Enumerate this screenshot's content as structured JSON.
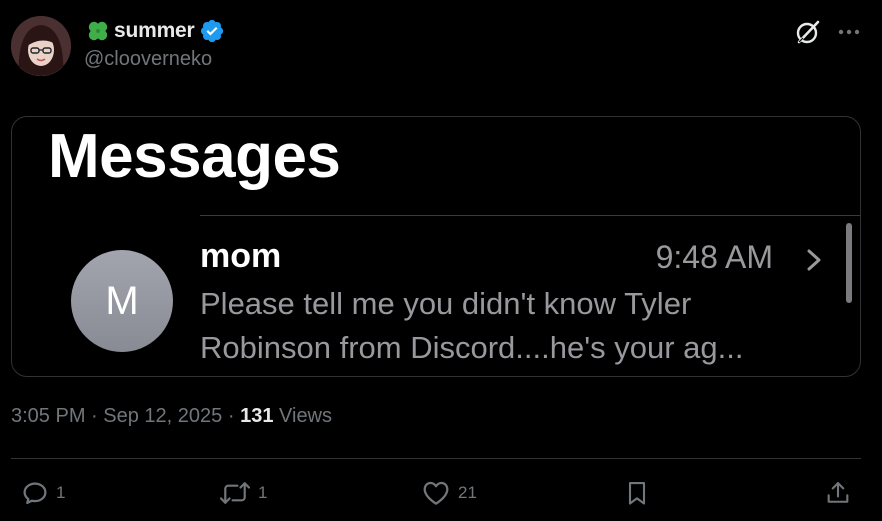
{
  "author": {
    "display_name": "summer",
    "handle": "@clooverneko",
    "name_emoji": "four-leaf-clover-icon",
    "verified": true,
    "verified_color": "#1d9bf0"
  },
  "media": {
    "app_title": "Messages",
    "conversation": {
      "avatar_initial": "M",
      "sender": "mom",
      "time": "9:48 AM",
      "preview_line_1": "Please tell me you didn't know Tyler",
      "preview_line_2": "Robinson from Discord....he's your ag..."
    }
  },
  "meta": {
    "time": "3:05 PM",
    "separator": "·",
    "date": "Sep 12, 2025",
    "views_count": "131",
    "views_label": "Views"
  },
  "actions": {
    "replies": "1",
    "reposts": "1",
    "likes": "21"
  },
  "colors": {
    "background": "#000000",
    "text_primary": "#e7e9ea",
    "text_secondary": "#71767b",
    "border": "#2f3336",
    "clover_green": "#3fae49"
  }
}
